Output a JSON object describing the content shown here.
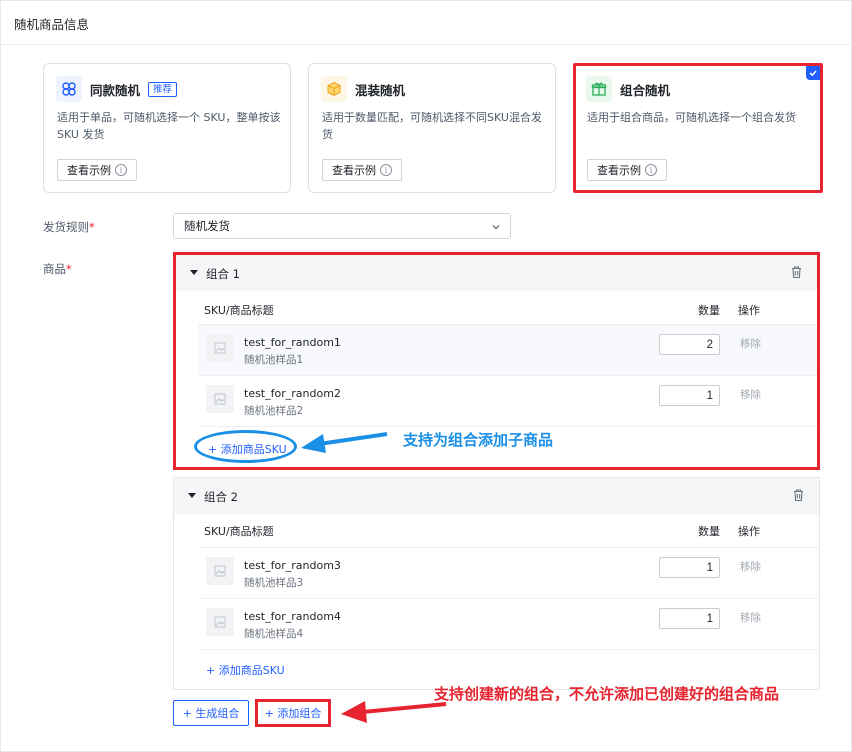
{
  "page": {
    "title": "随机商品信息"
  },
  "modes": [
    {
      "name": "同款随机",
      "badge": "推荐",
      "desc": "适用于单品，可随机选择一个 SKU，整单按该 SKU 发货",
      "example_label": "查看示例",
      "icon": "nodes-icon"
    },
    {
      "name": "混装随机",
      "badge": "",
      "desc": "适用于数量匹配，可随机选择不同SKU混合发货",
      "example_label": "查看示例",
      "icon": "box-icon"
    },
    {
      "name": "组合随机",
      "badge": "",
      "desc": "适用于组合商品，可随机选择一个组合发货",
      "example_label": "查看示例",
      "icon": "gift-icon",
      "selected": true
    }
  ],
  "form": {
    "ship_rule_label": "发货规则",
    "ship_rule_value": "随机发货",
    "product_label": "商品",
    "required_mark": "*"
  },
  "table": {
    "col_title": "SKU/商品标题",
    "col_qty": "数量",
    "col_action": "操作"
  },
  "groups": [
    {
      "title": "组合 1",
      "items": [
        {
          "name": "test_for_random1",
          "sub": "随机池样品1",
          "qty": "2",
          "action": "移除"
        },
        {
          "name": "test_for_random2",
          "sub": "随机池样品2",
          "qty": "1",
          "action": "移除"
        }
      ],
      "add_sku_label": "+ 添加商品SKU"
    },
    {
      "title": "组合 2",
      "items": [
        {
          "name": "test_for_random3",
          "sub": "随机池样品3",
          "qty": "1",
          "action": "移除"
        },
        {
          "name": "test_for_random4",
          "sub": "随机池样品4",
          "qty": "1",
          "action": "移除"
        }
      ],
      "add_sku_label": "+ 添加商品SKU"
    }
  ],
  "actions": {
    "generate_label": "+ 生成组合",
    "add_group_label": "+ 添加组合"
  },
  "annotations": {
    "blue": "支持为组合添加子商品",
    "red": "支持创建新的组合，不允许添加已创建好的组合商品"
  },
  "colors": {
    "accent": "#1f5eff",
    "highlight_red": "#e6242f",
    "annot_blue": "#1a8fe6"
  }
}
